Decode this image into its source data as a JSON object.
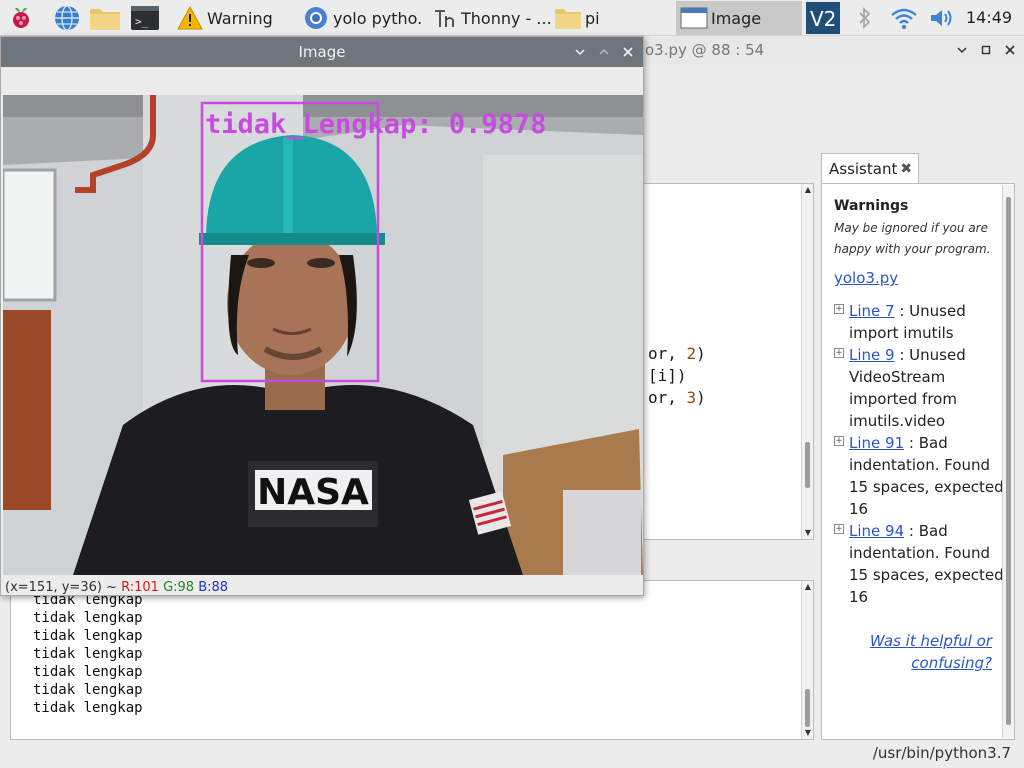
{
  "taskbar": {
    "launchers": [
      {
        "icon": "raspberry-menu-icon"
      },
      {
        "icon": "web-browser-icon"
      },
      {
        "icon": "file-manager-icon"
      },
      {
        "icon": "terminal-icon"
      }
    ],
    "tasks": [
      {
        "label": "Warning",
        "icon": "warning-icon"
      },
      {
        "label": "yolo pytho...",
        "icon": "chromium-icon"
      },
      {
        "label": "Thonny  -  ...",
        "icon": "thonny-icon"
      },
      {
        "label": "pi",
        "icon": "folder-icon"
      },
      {
        "label": "Image",
        "icon": "window-icon",
        "active": true
      }
    ],
    "tray": [
      "vnc-icon",
      "bluetooth-icon",
      "wifi-icon",
      "volume-icon"
    ],
    "clock": "14:49"
  },
  "thonny": {
    "title_fragment": "o3.py  @  88 : 54",
    "code_lines": [
      {
        "text": "or, ",
        "num": "2",
        "end": ")"
      },
      {
        "text": "[i])",
        "num": "",
        "end": ""
      },
      {
        "text": "or, ",
        "num": "3",
        "end": ")"
      }
    ],
    "shell_lines": [
      "tidak lengkap",
      "tidak lengkap",
      "tidak lengkap",
      "tidak lengkap",
      "tidak lengkap",
      "tidak lengkap",
      "tidak lengkap"
    ],
    "status": "/usr/bin/python3.7"
  },
  "assistant": {
    "tab_label": "Assistant",
    "heading": "Warnings",
    "subtitle": "May be ignored if you are happy with your program.",
    "file_link": "yolo3.py",
    "warnings": [
      {
        "link": "Line 7",
        "text": " : Unused import imutils"
      },
      {
        "link": "Line 9",
        "text": " : Unused VideoStream imported from imutils.video"
      },
      {
        "link": "Line 91",
        "text": " : Bad indentation. Found 15 spaces, expected 16"
      },
      {
        "link": "Line 94",
        "text": " : Bad indentation. Found 15 spaces, expected 16"
      }
    ],
    "help_link": "Was it helpful or confusing?"
  },
  "image_window": {
    "title": "Image",
    "detection_label": "tidak_Lengkap: 0.9878",
    "shirt_text": "NASA",
    "status": {
      "coords": "(x=151, y=36) ~ ",
      "r": "R:101",
      "g": "G:98",
      "b": "B:88"
    }
  },
  "colors": {
    "taskbar_bg": "#ececec",
    "image_titlebar": "#6d767d",
    "bbox": "#c84be0",
    "link": "#2a56c6",
    "helmet": "#1aa6a6"
  }
}
